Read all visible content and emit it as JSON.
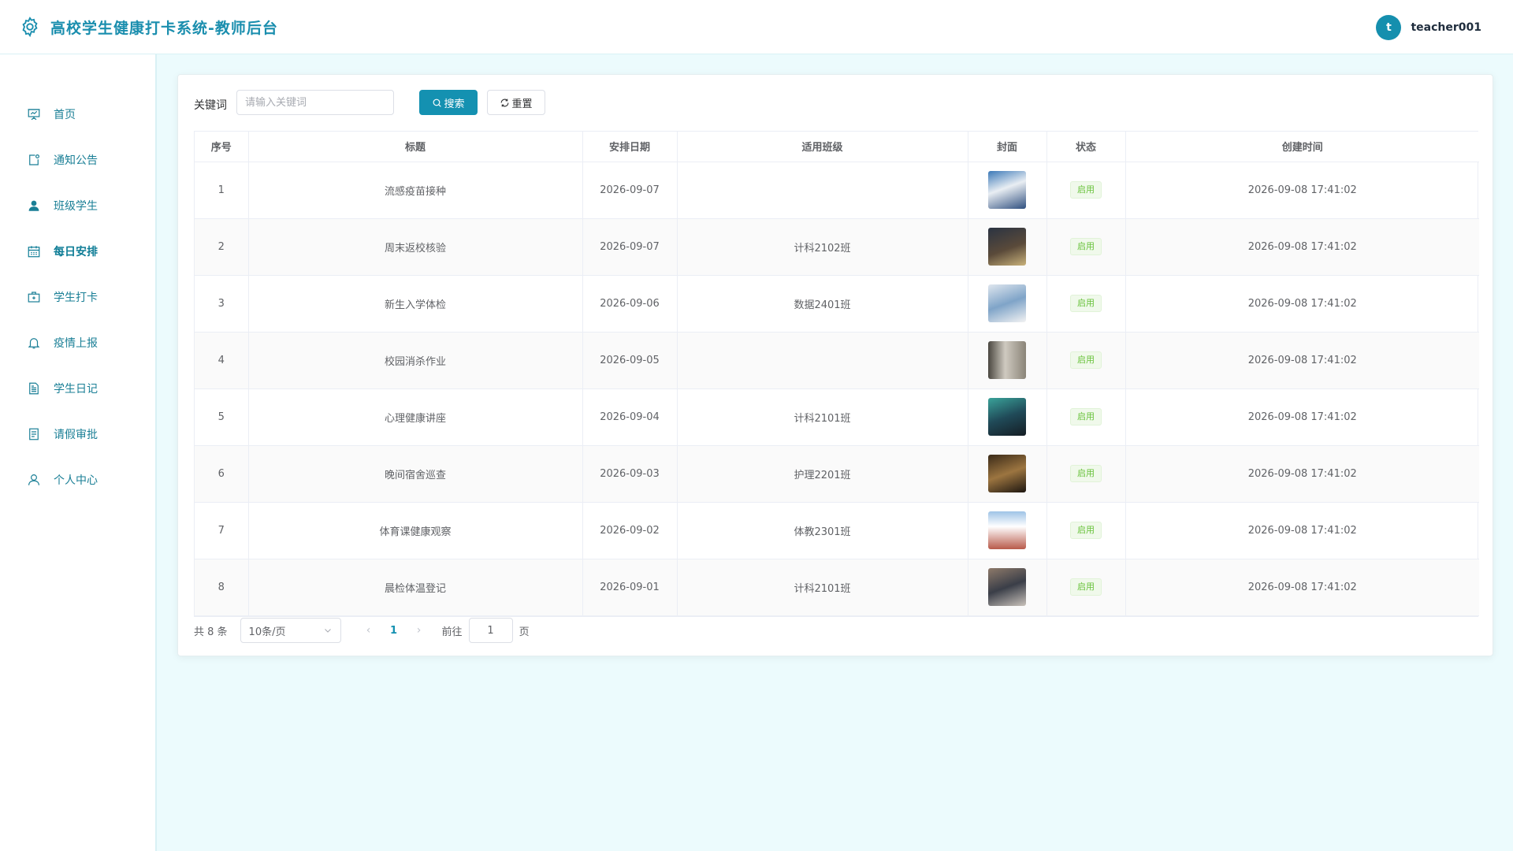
{
  "header": {
    "title": "高校学生健康打卡系统-教师后台",
    "avatar_letter": "t",
    "username": "teacher001"
  },
  "sidebar": {
    "items": [
      {
        "label": "首页",
        "icon": "presentation-icon"
      },
      {
        "label": "通知公告",
        "icon": "notice-icon"
      },
      {
        "label": "班级学生",
        "icon": "user-filled-icon"
      },
      {
        "label": "每日安排",
        "icon": "calendar-icon",
        "active": true
      },
      {
        "label": "学生打卡",
        "icon": "first-aid-kit-icon"
      },
      {
        "label": "疫情上报",
        "icon": "bell-icon"
      },
      {
        "label": "学生日记",
        "icon": "document-icon"
      },
      {
        "label": "请假审批",
        "icon": "tickets-icon"
      },
      {
        "label": "个人中心",
        "icon": "user-icon"
      }
    ]
  },
  "search": {
    "label": "关键词",
    "placeholder": "请输入关键词",
    "value": "",
    "search_button": "搜索",
    "reset_button": "重置"
  },
  "table": {
    "columns": [
      "序号",
      "标题",
      "安排日期",
      "适用班级",
      "封面",
      "状态",
      "创建时间"
    ],
    "rows": [
      {
        "index": "1",
        "title": "流感疫苗接种",
        "date": "2026-09-07",
        "class": "",
        "status": "启用",
        "created": "2026-09-08 17:41:02"
      },
      {
        "index": "2",
        "title": "周末返校核验",
        "date": "2026-09-07",
        "class": "计科2102班",
        "status": "启用",
        "created": "2026-09-08 17:41:02"
      },
      {
        "index": "3",
        "title": "新生入学体检",
        "date": "2026-09-06",
        "class": "数据2401班",
        "status": "启用",
        "created": "2026-09-08 17:41:02"
      },
      {
        "index": "4",
        "title": "校园消杀作业",
        "date": "2026-09-05",
        "class": "",
        "status": "启用",
        "created": "2026-09-08 17:41:02"
      },
      {
        "index": "5",
        "title": "心理健康讲座",
        "date": "2026-09-04",
        "class": "计科2101班",
        "status": "启用",
        "created": "2026-09-08 17:41:02"
      },
      {
        "index": "6",
        "title": "晚间宿舍巡查",
        "date": "2026-09-03",
        "class": "护理2201班",
        "status": "启用",
        "created": "2026-09-08 17:41:02"
      },
      {
        "index": "7",
        "title": "体育课健康观察",
        "date": "2026-09-02",
        "class": "体教2301班",
        "status": "启用",
        "created": "2026-09-08 17:41:02"
      },
      {
        "index": "8",
        "title": "晨检体温登记",
        "date": "2026-09-01",
        "class": "计科2101班",
        "status": "启用",
        "created": "2026-09-08 17:41:02"
      }
    ]
  },
  "pagination": {
    "total": "共 8 条",
    "page_size": "10条/页",
    "current_page": "1",
    "goto_label": "前往",
    "goto_value": "1",
    "page_suffix": "页"
  },
  "colors": {
    "accent": "#1491b1",
    "title": "#1a8eae",
    "background": "#ecfbfd",
    "status_green": "#67c23a"
  }
}
